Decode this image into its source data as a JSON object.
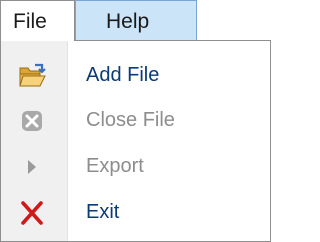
{
  "menubar": {
    "file_label": "File",
    "help_label": "Help"
  },
  "file_menu": {
    "items": [
      {
        "label": "Add File",
        "icon": "folder-open-icon",
        "enabled": true
      },
      {
        "label": "Close File",
        "icon": "close-file-icon",
        "enabled": false
      },
      {
        "label": "Export",
        "icon": "play-arrow-icon",
        "enabled": false
      },
      {
        "label": "Exit",
        "icon": "red-x-icon",
        "enabled": true
      }
    ]
  },
  "colors": {
    "enabled_text": "#0a3a78",
    "disabled_text": "#8d8d8d",
    "help_highlight": "#cce4f7",
    "exit_icon": "#d01a1a",
    "folder_icon": "#e8b84a"
  }
}
